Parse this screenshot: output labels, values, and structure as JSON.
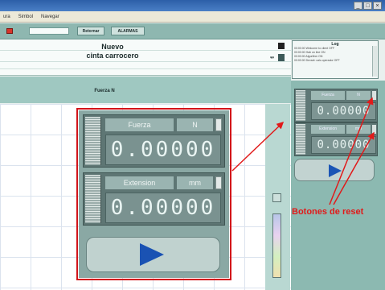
{
  "menu": [
    "ura",
    "Simbol",
    "Navegar"
  ],
  "toolbar": {
    "btn1": "Retornar",
    "btn2": "ALARMAS"
  },
  "header": {
    "title": "Nuevo",
    "subtitle": "cinta carrocero"
  },
  "log": {
    "title": "Log",
    "entries": [
      "00:00:00   Welcome to client OFF",
      "00:00:00   Hab on line ON",
      "00:00:00   Algorithm ON",
      "00:00:00   Devset: calc.operador OFF"
    ]
  },
  "graph": {
    "title": "Fuerza  N"
  },
  "widgets": [
    {
      "label": "Fuerza",
      "unit": "N",
      "value": "0.00000"
    },
    {
      "label": "Extension",
      "unit": "mm",
      "value": "0.00000"
    }
  ],
  "right_widgets": [
    {
      "label": "Fuerza",
      "unit": "N",
      "value": "0.00000"
    },
    {
      "label": "Extension",
      "unit": "mm",
      "value": "0.00000"
    }
  ],
  "annotation": "Botones de reset",
  "colors": {
    "highlight": "#d3141a",
    "play": "#1a52b3",
    "panel": "#8cb9b1"
  }
}
